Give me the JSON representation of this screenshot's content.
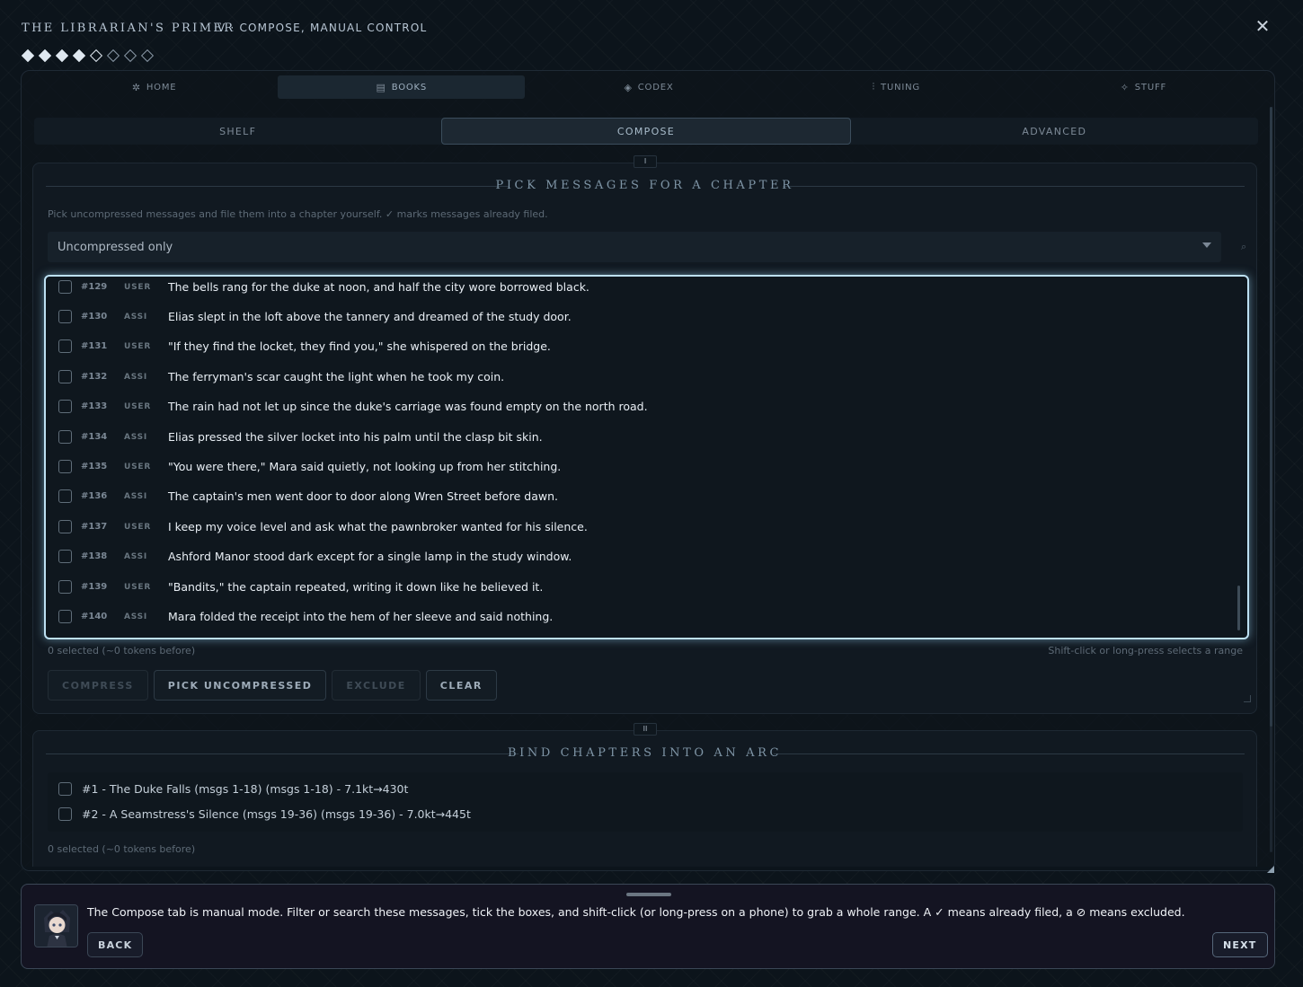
{
  "header": {
    "app_title": "THE LIBRARIAN'S PRIMER",
    "step_title": "V · COMPOSE, MANUAL CONTROL",
    "close_icon": "close-icon",
    "progress": {
      "total": 8,
      "completed": 4,
      "current": 5
    }
  },
  "main_tabs": [
    {
      "label": "HOME",
      "icon": "sparkle-icon",
      "active": false
    },
    {
      "label": "BOOKS",
      "icon": "book-icon",
      "active": true
    },
    {
      "label": "CODEX",
      "icon": "diamond-icon",
      "active": false
    },
    {
      "label": "TUNING",
      "icon": "sliders-icon",
      "active": false
    },
    {
      "label": "STUFF",
      "icon": "sparkles-icon",
      "active": false
    }
  ],
  "sub_tabs": [
    {
      "label": "SHELF",
      "active": false
    },
    {
      "label": "COMPOSE",
      "active": true
    },
    {
      "label": "ADVANCED",
      "active": false
    }
  ],
  "compose": {
    "number": "I",
    "heading": "PICK MESSAGES FOR A CHAPTER",
    "description": "Pick uncompressed messages and file them into a chapter yourself. ✓ marks messages already filed.",
    "filter_value": "Uncompressed only",
    "messages": [
      {
        "num": "#129",
        "role": "USER",
        "text": "The bells rang for the duke at noon, and half the city wore borrowed black."
      },
      {
        "num": "#130",
        "role": "ASSI",
        "text": "Elias slept in the loft above the tannery and dreamed of the study door."
      },
      {
        "num": "#131",
        "role": "USER",
        "text": "\"If they find the locket, they find you,\" she whispered on the bridge."
      },
      {
        "num": "#132",
        "role": "ASSI",
        "text": "The ferryman's scar caught the light when he took my coin."
      },
      {
        "num": "#133",
        "role": "USER",
        "text": "The rain had not let up since the duke's carriage was found empty on the north road."
      },
      {
        "num": "#134",
        "role": "ASSI",
        "text": "Elias pressed the silver locket into his palm until the clasp bit skin."
      },
      {
        "num": "#135",
        "role": "USER",
        "text": "\"You were there,\" Mara said quietly, not looking up from her stitching."
      },
      {
        "num": "#136",
        "role": "ASSI",
        "text": "The captain's men went door to door along Wren Street before dawn."
      },
      {
        "num": "#137",
        "role": "USER",
        "text": "I keep my voice level and ask what the pawnbroker wanted for his silence."
      },
      {
        "num": "#138",
        "role": "ASSI",
        "text": "Ashford Manor stood dark except for a single lamp in the study window."
      },
      {
        "num": "#139",
        "role": "USER",
        "text": "\"Bandits,\" the captain repeated, writing it down like he believed it."
      },
      {
        "num": "#140",
        "role": "ASSI",
        "text": "Mara folded the receipt into the hem of her sleeve and said nothing."
      }
    ],
    "selected_count": "0 selected (~0 tokens before)",
    "range_hint": "Shift-click or long-press selects a range",
    "buttons": {
      "compress": "COMPRESS",
      "pick_uncompressed": "PICK UNCOMPRESSED",
      "exclude": "EXCLUDE",
      "clear": "CLEAR"
    }
  },
  "arc": {
    "number": "II",
    "heading": "BIND CHAPTERS INTO AN ARC",
    "chapters": [
      {
        "label": "#1 - The Duke Falls (msgs 1-18) (msgs 1-18) - 7.1kt→430t"
      },
      {
        "label": "#2 - A Seamstress's Silence (msgs 19-36) (msgs 19-36) - 7.0kt→445t"
      }
    ],
    "selected_count": "0 selected (~0 tokens before)"
  },
  "guide": {
    "avatar": "librarian-avatar",
    "text": "The Compose tab is manual mode. Filter or search these messages, tick the boxes, and shift-click (or long-press on a phone) to grab a whole range. A ✓ means already filed, a ⊘ means excluded.",
    "back_label": "BACK",
    "next_label": "NEXT"
  }
}
